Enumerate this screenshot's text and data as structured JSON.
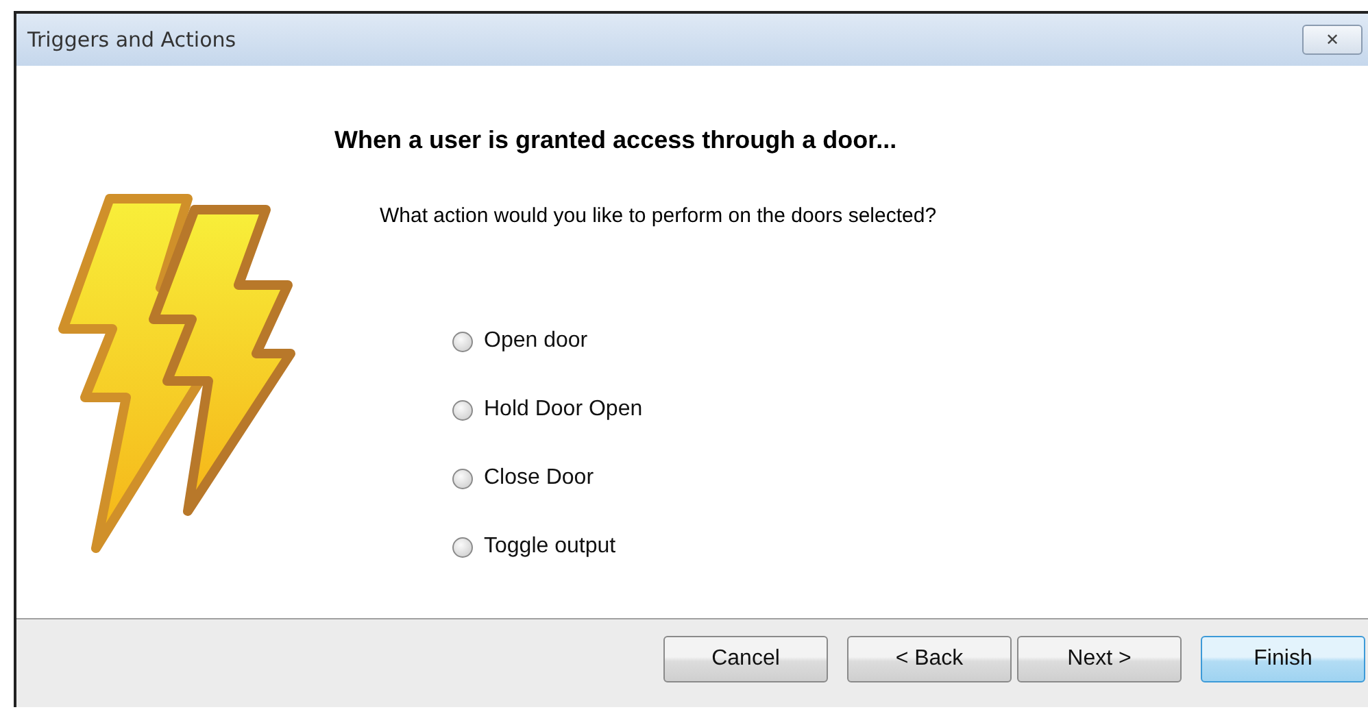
{
  "window": {
    "title": "Triggers and Actions",
    "close": "✕"
  },
  "heading": "When a user is granted access through a door...",
  "question": "What action would you like to perform on the doors selected?",
  "options": [
    {
      "label": "Open door",
      "selected": false
    },
    {
      "label": "Hold Door Open",
      "selected": false
    },
    {
      "label": "Close Door",
      "selected": false
    },
    {
      "label": "Toggle output",
      "selected": false
    }
  ],
  "buttons": [
    {
      "label": "Cancel",
      "default": false
    },
    {
      "label": "< Back",
      "default": false
    },
    {
      "label": "Next >",
      "default": false
    },
    {
      "label": "Finish",
      "default": true
    }
  ]
}
